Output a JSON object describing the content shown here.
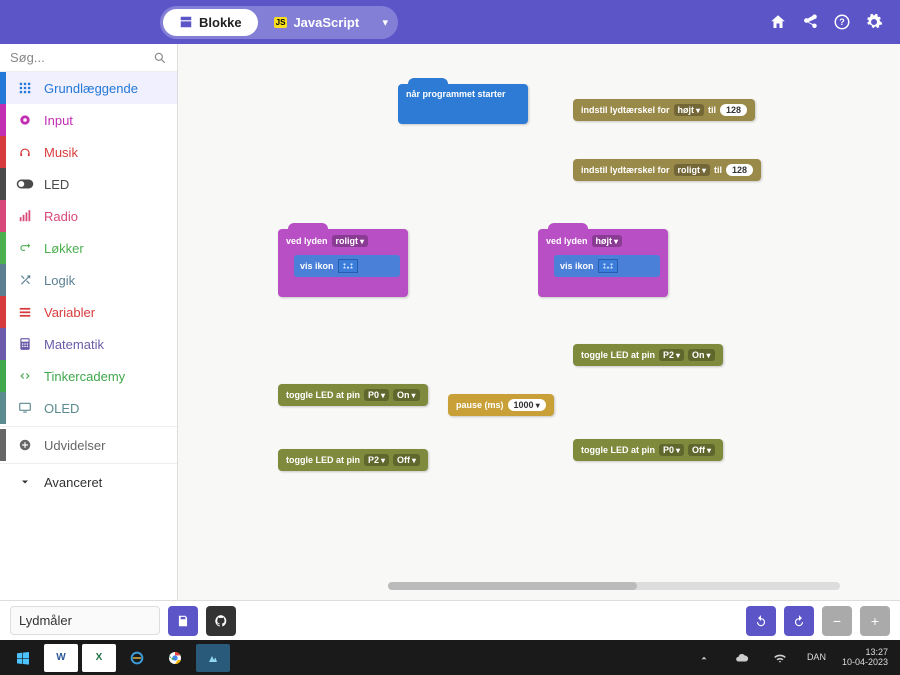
{
  "topbar": {
    "blokke_label": "Blokke",
    "javascript_label": "JavaScript"
  },
  "search": {
    "placeholder": "Søg..."
  },
  "categories": [
    {
      "label": "Grundlæggende",
      "color": "#2478d8",
      "icon": "grid",
      "selected": true
    },
    {
      "label": "Input",
      "color": "#c22eb2",
      "icon": "circle-dot"
    },
    {
      "label": "Musik",
      "color": "#d83b3b",
      "icon": "headphones"
    },
    {
      "label": "LED",
      "color": "#4a4a4a",
      "icon": "toggle"
    },
    {
      "label": "Radio",
      "color": "#d8487a",
      "icon": "bars"
    },
    {
      "label": "Løkker",
      "color": "#4caf50",
      "icon": "loop"
    },
    {
      "label": "Logik",
      "color": "#5b7f8f",
      "icon": "shuffle"
    },
    {
      "label": "Variabler",
      "color": "#d83b3b",
      "icon": "lines"
    },
    {
      "label": "Matematik",
      "color": "#6b5ba8",
      "icon": "calc"
    },
    {
      "label": "Tinkercademy",
      "color": "#3fa84c",
      "icon": "code"
    },
    {
      "label": "OLED",
      "color": "#5b8a8f",
      "icon": "monitor"
    },
    {
      "label": "Udvidelser",
      "color": "#666",
      "icon": "plus"
    }
  ],
  "advanced_label": "Avanceret",
  "blocks": {
    "on_start": {
      "label": "når programmet starter"
    },
    "thresh1": {
      "prefix": "indstil lydtærskel for",
      "level": "højt",
      "mid": "til",
      "value": "128"
    },
    "thresh2": {
      "prefix": "indstil lydtærskel for",
      "level": "roligt",
      "mid": "til",
      "value": "128"
    },
    "sound1": {
      "prefix": "ved lyden",
      "level": "roligt",
      "inner_label": "vis ikon"
    },
    "sound2": {
      "prefix": "ved lyden",
      "level": "højt",
      "inner_label": "vis ikon"
    },
    "toggle1": {
      "prefix": "toggle LED at pin",
      "pin": "P0",
      "state": "On"
    },
    "toggle2": {
      "prefix": "toggle LED at pin",
      "pin": "P2",
      "state": "Off"
    },
    "toggle3": {
      "prefix": "toggle LED at pin",
      "pin": "P2",
      "state": "On"
    },
    "toggle4": {
      "prefix": "toggle LED at pin",
      "pin": "P0",
      "state": "Off"
    },
    "pause": {
      "prefix": "pause (ms)",
      "value": "1000"
    }
  },
  "project_name": "Lydmåler",
  "taskbar": {
    "lang": "DAN",
    "time": "13:27",
    "date": "10-04-2023"
  }
}
